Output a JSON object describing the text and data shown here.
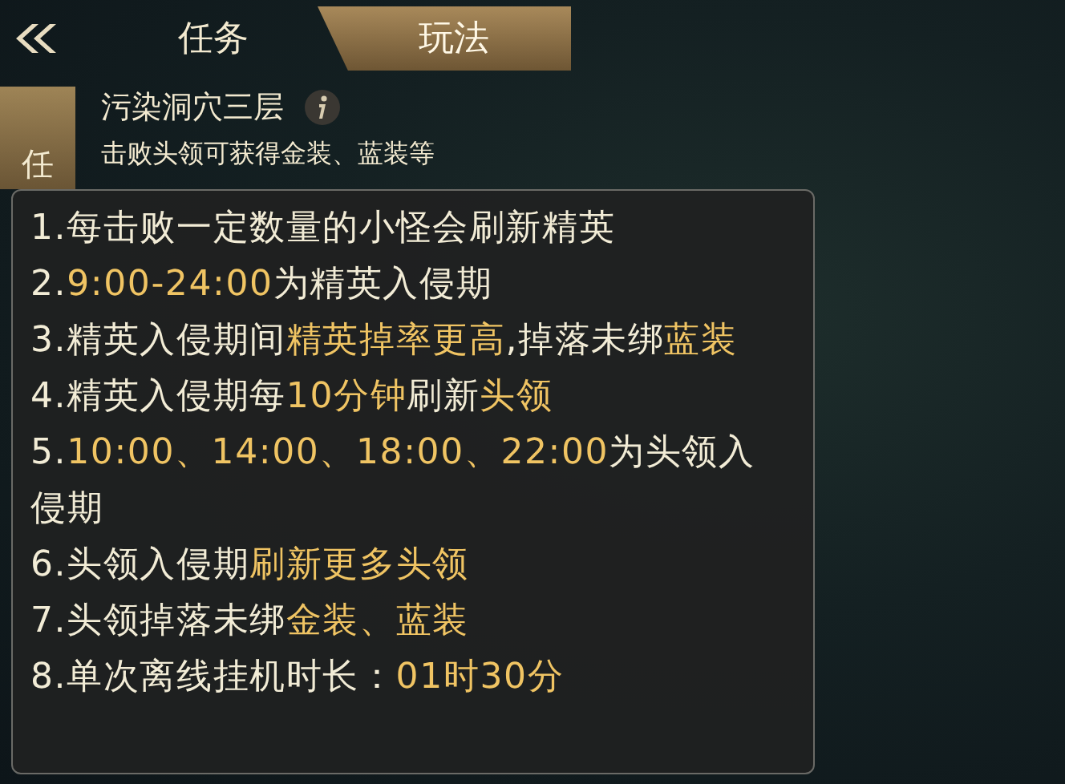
{
  "tabs": [
    {
      "label": "任务",
      "selected": false
    },
    {
      "label": "玩法",
      "selected": true
    }
  ],
  "side_tab": {
    "label": "任",
    "selected": true
  },
  "dungeon": {
    "title": "污染洞穴三层",
    "description": "击败头领可获得金装、蓝装等"
  },
  "tooltip": {
    "lines": [
      [
        {
          "text": "1.每击败一定数量的小怪会刷新精英",
          "highlight": false
        }
      ],
      [
        {
          "text": "2.",
          "highlight": false
        },
        {
          "text": "9:00-24:00",
          "highlight": true
        },
        {
          "text": "为精英入侵期",
          "highlight": false
        }
      ],
      [
        {
          "text": "3.精英入侵期间",
          "highlight": false
        },
        {
          "text": "精英掉率更高",
          "highlight": true
        },
        {
          "text": ",掉落未绑",
          "highlight": false
        },
        {
          "text": "蓝装",
          "highlight": true
        }
      ],
      [
        {
          "text": "4.精英入侵期每",
          "highlight": false
        },
        {
          "text": "10分钟",
          "highlight": true
        },
        {
          "text": "刷新",
          "highlight": false
        },
        {
          "text": "头领",
          "highlight": true
        }
      ],
      [
        {
          "text": "5.",
          "highlight": false
        },
        {
          "text": "10:00、14:00、18:00、22:00",
          "highlight": true
        },
        {
          "text": "为头领入侵期",
          "highlight": false
        }
      ],
      [
        {
          "text": "6.头领入侵期",
          "highlight": false
        },
        {
          "text": "刷新更多头领",
          "highlight": true
        }
      ],
      [
        {
          "text": "7.头领掉落未绑",
          "highlight": false
        },
        {
          "text": "金装、蓝装",
          "highlight": true
        }
      ],
      [
        {
          "text": "8.单次离线挂机时长：",
          "highlight": false
        },
        {
          "text": "01时30分",
          "highlight": true
        }
      ]
    ]
  }
}
